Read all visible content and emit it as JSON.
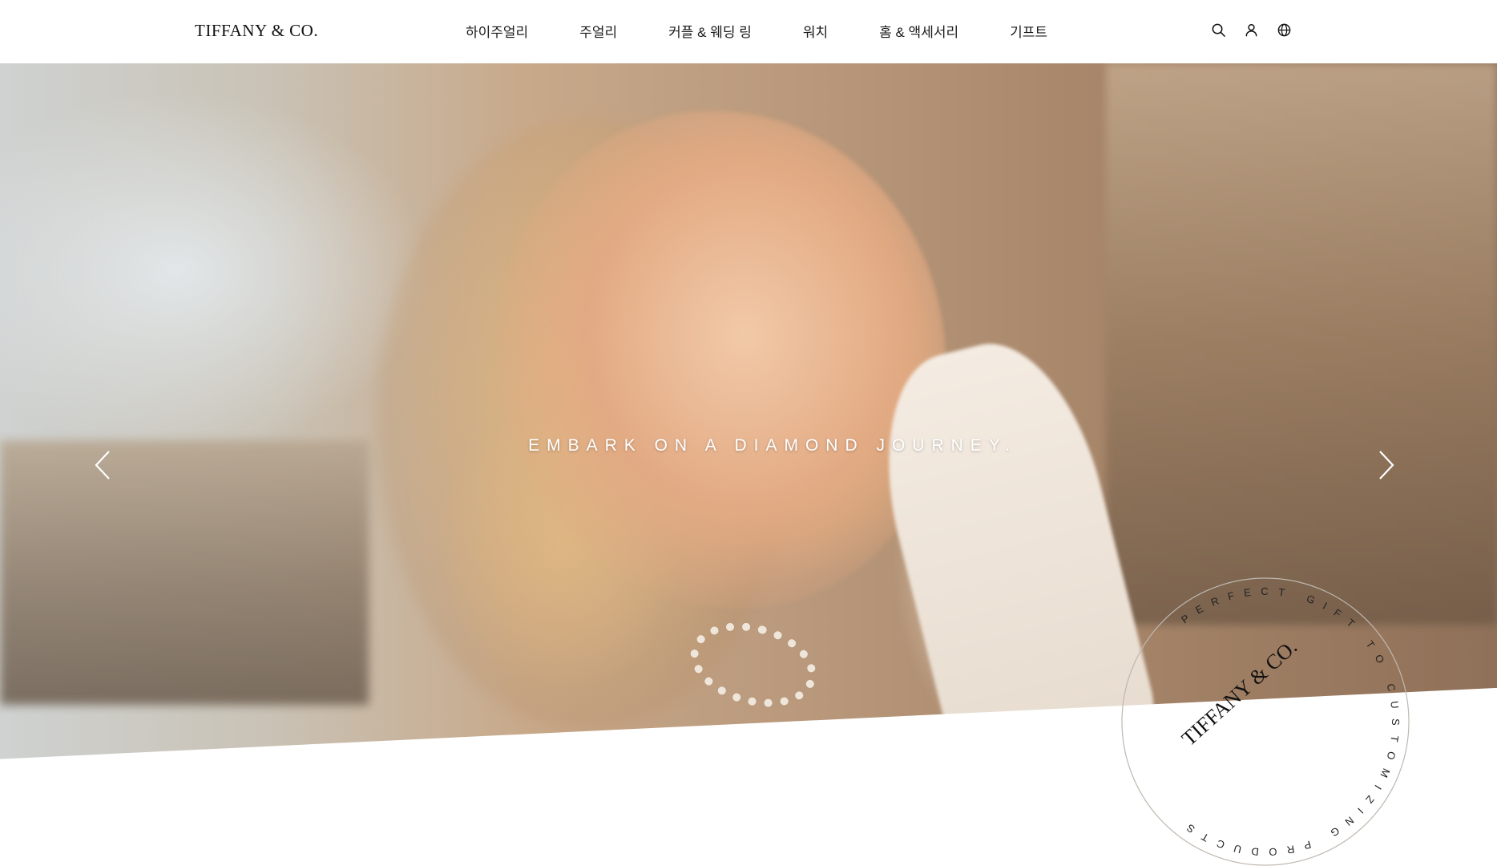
{
  "header": {
    "logo": "TIFFANY & CO.",
    "nav": [
      {
        "label": "하이주얼리"
      },
      {
        "label": "주얼리"
      },
      {
        "label": "커플 & 웨딩 링"
      },
      {
        "label": "워치"
      },
      {
        "label": "홈 & 액세서리"
      },
      {
        "label": "기프트"
      }
    ],
    "icons": [
      "search-icon",
      "account-icon",
      "globe-icon"
    ]
  },
  "hero": {
    "caption": "EMBARK ON A DIAMOND JOURNEY.",
    "prev_icon": "chevron-left-icon",
    "next_icon": "chevron-right-icon"
  },
  "badge": {
    "ring_text": "PERFECT GIFT TO CUSTOMIZING PRODUCTS",
    "logo": "TIFFANY & CO."
  }
}
